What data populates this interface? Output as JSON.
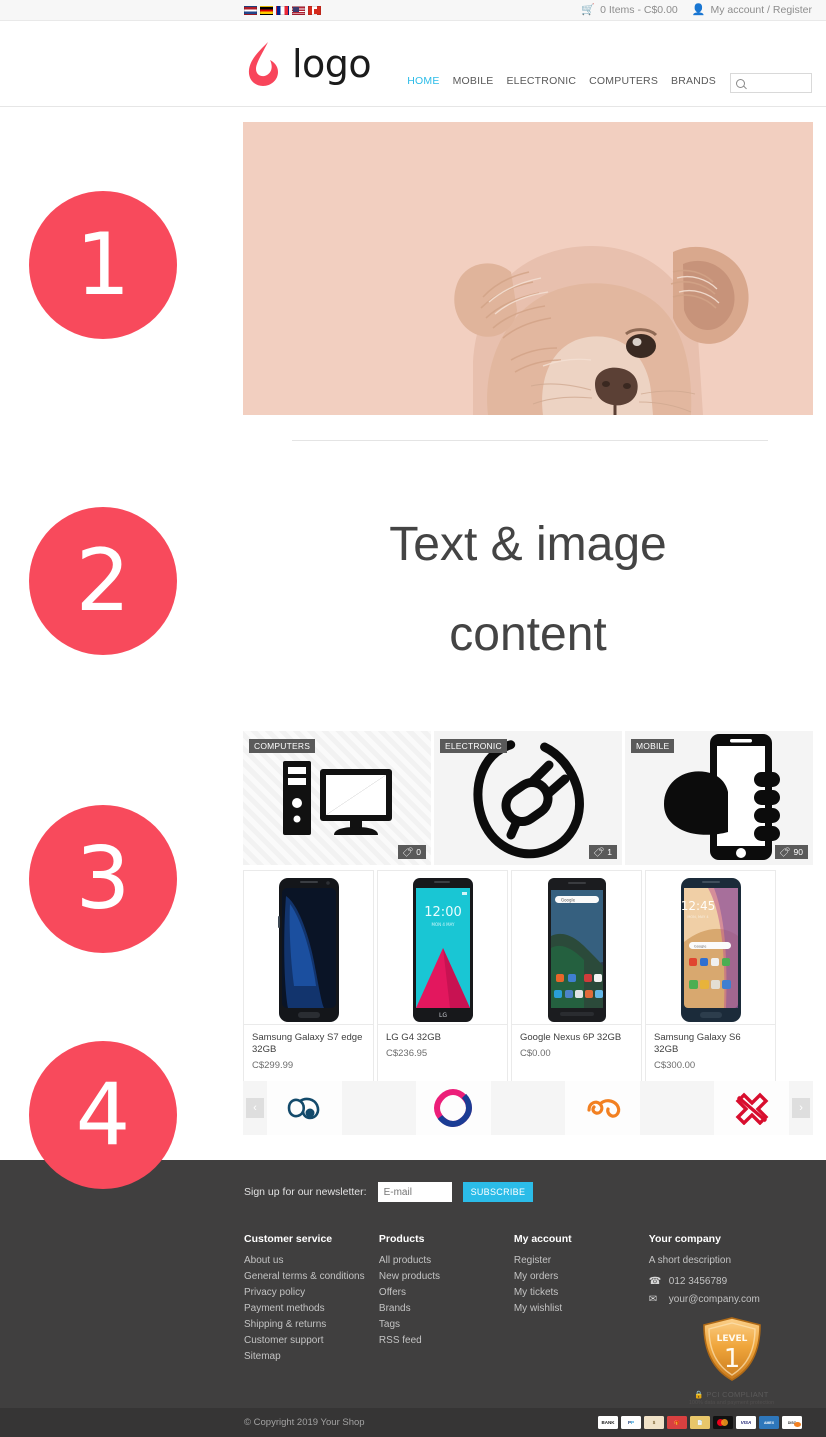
{
  "topbar": {
    "languages": [
      {
        "code": "nl",
        "name": "dutch-flag"
      },
      {
        "code": "de",
        "name": "german-flag"
      },
      {
        "code": "fr",
        "name": "french-flag"
      },
      {
        "code": "us",
        "name": "us-flag"
      },
      {
        "code": "ca",
        "name": "canadian-flag"
      }
    ],
    "cart_icon": "cart-icon",
    "cart_label": "0 Items - C$0.00",
    "account_icon": "user-icon",
    "account_label": "My account / Register"
  },
  "header": {
    "logo_text": "logo",
    "logo_color": "#F8455B",
    "nav": [
      {
        "label": "HOME",
        "active": true
      },
      {
        "label": "MOBILE",
        "active": false
      },
      {
        "label": "ELECTRONIC",
        "active": false
      },
      {
        "label": "COMPUTERS",
        "active": false
      },
      {
        "label": "BRANDS",
        "active": false
      }
    ],
    "active_color": "#2bbce8",
    "search": {
      "placeholder": "",
      "value": "",
      "icon": "search-icon"
    }
  },
  "markers": [
    {
      "number": "1"
    },
    {
      "number": "2"
    },
    {
      "number": "3"
    },
    {
      "number": "4"
    }
  ],
  "marker_color": "#F84A5C",
  "hero": {
    "alt": "dog-banner-image",
    "background": "#F2CFC0"
  },
  "content": {
    "title_line1": "Text & image",
    "title_line2": "content"
  },
  "categories": [
    {
      "label": "COMPUTERS",
      "count": "0",
      "icon": "desktop-computer-icon"
    },
    {
      "label": "ELECTRONIC",
      "count": "1",
      "icon": "power-plug-icon"
    },
    {
      "label": "MOBILE",
      "count": "90",
      "icon": "hand-holding-phone-icon"
    }
  ],
  "products": [
    {
      "name": "Samsung Galaxy S7 edge 32GB",
      "price": "C$299.99",
      "image": "samsung-galaxy-s7-edge-photo"
    },
    {
      "name": "LG G4 32GB",
      "price": "C$236.95",
      "image": "lg-g4-photo"
    },
    {
      "name": "Google Nexus 6P 32GB",
      "price": "C$0.00",
      "image": "google-nexus-6p-photo"
    },
    {
      "name": "Samsung Galaxy S6 32GB",
      "price": "C$300.00",
      "image": "samsung-galaxy-s6-photo"
    }
  ],
  "brands": {
    "prev_icon": "chevron-left-icon",
    "next_icon": "chevron-right-icon",
    "logos": [
      {
        "name": "brand-logo-navy-swirl",
        "color": "#134A6B"
      },
      {
        "name": "brand-logo-pink-blue-diamond",
        "color": "#EC1E79"
      },
      {
        "name": "brand-logo-orange-swirl",
        "color": "#F28021"
      },
      {
        "name": "brand-logo-red-cross",
        "color": "#D80E2E"
      }
    ]
  },
  "footer": {
    "newsletter": {
      "label": "Sign up for our newsletter:",
      "placeholder": "E-mail",
      "value": "",
      "button": "SUBSCRIBE",
      "button_color": "#2bbce8"
    },
    "columns": [
      {
        "heading": "Customer service",
        "links": [
          "About us",
          "General terms & conditions",
          "Privacy policy",
          "Payment methods",
          "Shipping & returns",
          "Customer support",
          "Sitemap"
        ]
      },
      {
        "heading": "Products",
        "links": [
          "All products",
          "New products",
          "Offers",
          "Brands",
          "Tags",
          "RSS feed"
        ]
      },
      {
        "heading": "My account",
        "links": [
          "Register",
          "My orders",
          "My tickets",
          "My wishlist"
        ]
      }
    ],
    "company": {
      "heading": "Your company",
      "description": "A short description",
      "phone_icon": "phone-icon",
      "phone": "012 3456789",
      "email_icon": "envelope-icon",
      "email": "your@company.com"
    },
    "pci": {
      "level_label": "LEVEL",
      "level_number": "1",
      "caption": "PCI COMPLIANT",
      "subcaption": "100% data and payment protection",
      "lock_icon": "lock-icon"
    },
    "copyright": "© Copyright 2019 Your Shop",
    "payments": [
      {
        "name": "bank-transfer-icon",
        "label": "BANK"
      },
      {
        "name": "paypal-icon",
        "label": "PayPal"
      },
      {
        "name": "cash-icon",
        "label": "CASH"
      },
      {
        "name": "giftcard-icon",
        "label": "GIFT"
      },
      {
        "name": "invoice-icon",
        "label": "INV"
      },
      {
        "name": "mastercard-icon",
        "label": "MC"
      },
      {
        "name": "visa-icon",
        "label": "VISA"
      },
      {
        "name": "american-express-icon",
        "label": "AMEX"
      },
      {
        "name": "discover-icon",
        "label": "DISC"
      }
    ]
  }
}
